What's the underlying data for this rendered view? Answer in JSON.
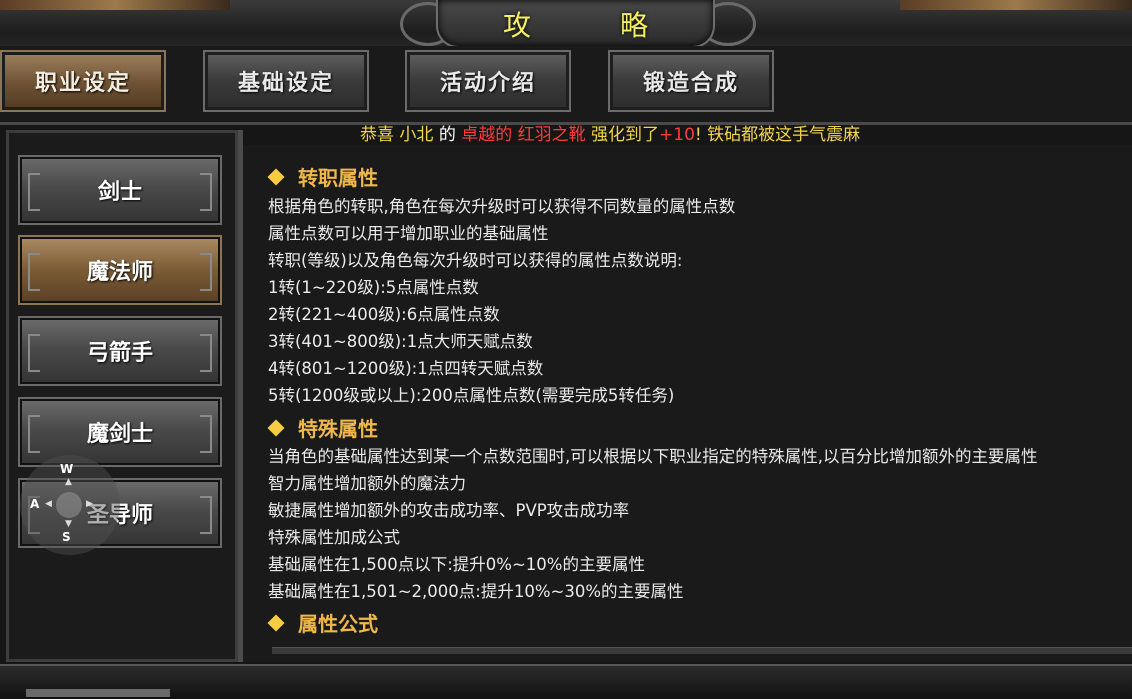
{
  "header": {
    "title": "攻 略"
  },
  "tabs": [
    {
      "label": "职业设定",
      "active": true
    },
    {
      "label": "基础设定",
      "active": false
    },
    {
      "label": "活动介绍",
      "active": false
    },
    {
      "label": "锻造合成",
      "active": false
    }
  ],
  "announcement": {
    "prefix": "恭喜",
    "player": "小北",
    "de": "的",
    "item": "卓越的 红羽之靴",
    "mid": "强化到了",
    "level": "+10",
    "suffix": "! 铁砧都被这手气震麻"
  },
  "classes": [
    {
      "label": "剑士",
      "active": false
    },
    {
      "label": "魔法师",
      "active": true
    },
    {
      "label": "弓箭手",
      "active": false
    },
    {
      "label": "魔剑士",
      "active": false
    },
    {
      "label": "圣导师",
      "active": false
    }
  ],
  "sections": {
    "transfer": {
      "title": "转职属性",
      "lines": [
        "根据角色的转职,角色在每次升级时可以获得不同数量的属性点数",
        "属性点数可以用于增加职业的基础属性",
        "转职(等级)以及角色每次升级时可以获得的属性点数说明:",
        "1转(1~220级):5点属性点数",
        "2转(221~400级):6点属性点数",
        "3转(401~800级):1点大师天赋点数",
        "4转(801~1200级):1点四转天赋点数",
        "5转(1200级或以上):200点属性点数(需要完成5转任务)"
      ]
    },
    "special": {
      "title": "特殊属性",
      "lines": [
        "当角色的基础属性达到某一个点数范围时,可以根据以下职业指定的特殊属性,以百分比增加额外的主要属性",
        "智力属性增加额外的魔法力",
        "敏捷属性增加额外的攻击成功率、PVP攻击成功率",
        "特殊属性加成公式",
        "基础属性在1,500点以下:提升0%~10%的主要属性",
        "基础属性在1,501~2,000点:提升10%~30%的主要属性"
      ]
    },
    "formula": {
      "title": "属性公式"
    }
  },
  "joystick": {
    "up": "W",
    "left": "A",
    "down": "S"
  },
  "colors": {
    "title": "#f6ef63",
    "section": "#f0b84a",
    "announce_red": "#ff3b3b",
    "announce_yellow": "#f2d54a"
  }
}
